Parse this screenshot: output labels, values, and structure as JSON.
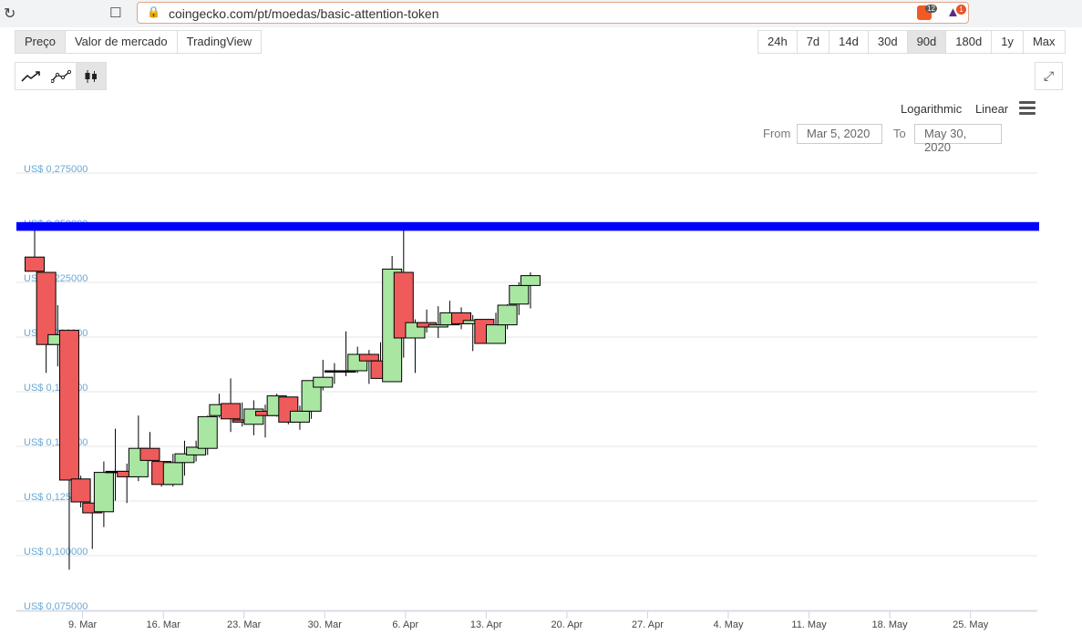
{
  "browser": {
    "url": "coingecko.com/pt/moedas/basic-attention-token",
    "ext1_badge": "12",
    "ext2_badge": "1"
  },
  "tabs": [
    "Preço",
    "Valor de mercado",
    "TradingView"
  ],
  "ranges": [
    "24h",
    "7d",
    "14d",
    "30d",
    "90d",
    "180d",
    "1y",
    "Max"
  ],
  "scales": {
    "log": "Logarithmic",
    "linear": "Linear"
  },
  "range_inputs": {
    "from_label": "From",
    "from_value": "Mar 5, 2020",
    "to_label": "To",
    "to_value": "May 30, 2020"
  },
  "colors": {
    "up": "#a8e6a1",
    "down": "#ef5b5b",
    "axis_text": "#6ba9d6",
    "grid": "#e6e6e6",
    "band": "#0000ff"
  },
  "chart_data": {
    "type": "candlestick",
    "y_ticks": [
      "US$ 0,275000",
      "US$ 0,250000",
      "US$ 0,225000",
      "US$ 0,200000",
      "US$ 0,175000",
      "US$ 0,150000",
      "US$ 0,125000",
      "US$ 0,100000",
      "US$ 0,075000"
    ],
    "y_tick_values": [
      0.275,
      0.25,
      0.225,
      0.2,
      0.175,
      0.15,
      0.125,
      0.1,
      0.075
    ],
    "ylim": [
      0.075,
      0.278
    ],
    "x_ticks": [
      "9. Mar",
      "16. Mar",
      "23. Mar",
      "30. Mar",
      "6. Apr",
      "13. Apr",
      "20. Apr",
      "27. Apr",
      "4. May",
      "11. May",
      "18. May",
      "25. May"
    ],
    "x_tick_days": [
      4,
      11,
      18,
      25,
      32,
      39,
      46,
      53,
      60,
      67,
      74,
      81
    ],
    "highlight_band": [
      0.2465,
      0.2505
    ],
    "candles": [
      {
        "day": 0,
        "o": 0.2345,
        "h": 0.2485,
        "l": 0.228,
        "c": 0.228
      },
      {
        "day": 1,
        "o": 0.2275,
        "h": 0.2275,
        "l": 0.1815,
        "c": 0.1945
      },
      {
        "day": 2,
        "o": 0.1945,
        "h": 0.2125,
        "l": 0.1845,
        "c": 0.199
      },
      {
        "day": 3,
        "o": 0.201,
        "h": 0.201,
        "l": 0.0915,
        "c": 0.1325
      },
      {
        "day": 4,
        "o": 0.133,
        "h": 0.1345,
        "l": 0.12,
        "c": 0.1225
      },
      {
        "day": 5,
        "o": 0.122,
        "h": 0.122,
        "l": 0.101,
        "c": 0.1175
      },
      {
        "day": 6,
        "o": 0.118,
        "h": 0.141,
        "l": 0.111,
        "c": 0.136
      },
      {
        "day": 7,
        "o": 0.136,
        "h": 0.156,
        "l": 0.123,
        "c": 0.1365
      },
      {
        "day": 8,
        "o": 0.1365,
        "h": 0.14,
        "l": 0.122,
        "c": 0.134
      },
      {
        "day": 9,
        "o": 0.134,
        "h": 0.162,
        "l": 0.132,
        "c": 0.147
      },
      {
        "day": 10,
        "o": 0.147,
        "h": 0.1545,
        "l": 0.141,
        "c": 0.1415
      },
      {
        "day": 11,
        "o": 0.141,
        "h": 0.141,
        "l": 0.1295,
        "c": 0.1305
      },
      {
        "day": 12,
        "o": 0.1305,
        "h": 0.1445,
        "l": 0.1295,
        "c": 0.1405
      },
      {
        "day": 13,
        "o": 0.1405,
        "h": 0.1505,
        "l": 0.1345,
        "c": 0.1445
      },
      {
        "day": 14,
        "o": 0.144,
        "h": 0.1505,
        "l": 0.141,
        "c": 0.1475
      },
      {
        "day": 15,
        "o": 0.147,
        "h": 0.162,
        "l": 0.144,
        "c": 0.1615
      },
      {
        "day": 16,
        "o": 0.162,
        "h": 0.172,
        "l": 0.161,
        "c": 0.167
      },
      {
        "day": 17,
        "o": 0.1675,
        "h": 0.179,
        "l": 0.1545,
        "c": 0.1605
      },
      {
        "day": 18,
        "o": 0.16,
        "h": 0.168,
        "l": 0.157,
        "c": 0.159
      },
      {
        "day": 19,
        "o": 0.158,
        "h": 0.169,
        "l": 0.153,
        "c": 0.165
      },
      {
        "day": 20,
        "o": 0.164,
        "h": 0.167,
        "l": 0.152,
        "c": 0.162
      },
      {
        "day": 21,
        "o": 0.162,
        "h": 0.172,
        "l": 0.1615,
        "c": 0.171
      },
      {
        "day": 22,
        "o": 0.1705,
        "h": 0.1705,
        "l": 0.158,
        "c": 0.159
      },
      {
        "day": 23,
        "o": 0.159,
        "h": 0.1665,
        "l": 0.1555,
        "c": 0.164
      },
      {
        "day": 24,
        "o": 0.164,
        "h": 0.178,
        "l": 0.1605,
        "c": 0.178
      },
      {
        "day": 25,
        "o": 0.175,
        "h": 0.1875,
        "l": 0.1735,
        "c": 0.1795
      },
      {
        "day": 26,
        "o": 0.1825,
        "h": 0.186,
        "l": 0.1765,
        "c": 0.1825
      },
      {
        "day": 27,
        "o": 0.1825,
        "h": 0.2005,
        "l": 0.18,
        "c": 0.1825
      },
      {
        "day": 28,
        "o": 0.1825,
        "h": 0.1935,
        "l": 0.1815,
        "c": 0.19
      },
      {
        "day": 29,
        "o": 0.19,
        "h": 0.192,
        "l": 0.1765,
        "c": 0.187
      },
      {
        "day": 30,
        "o": 0.187,
        "h": 0.1955,
        "l": 0.1795,
        "c": 0.179
      },
      {
        "day": 31,
        "o": 0.1775,
        "h": 0.235,
        "l": 0.1775,
        "c": 0.229
      },
      {
        "day": 32,
        "o": 0.2275,
        "h": 0.2485,
        "l": 0.1885,
        "c": 0.1975
      },
      {
        "day": 33,
        "o": 0.1975,
        "h": 0.206,
        "l": 0.1815,
        "c": 0.2045
      },
      {
        "day": 34,
        "o": 0.2045,
        "h": 0.2105,
        "l": 0.2,
        "c": 0.2025
      },
      {
        "day": 35,
        "o": 0.2025,
        "h": 0.212,
        "l": 0.1975,
        "c": 0.2035
      },
      {
        "day": 36,
        "o": 0.2035,
        "h": 0.2145,
        "l": 0.2035,
        "c": 0.209
      },
      {
        "day": 37,
        "o": 0.209,
        "h": 0.2115,
        "l": 0.2015,
        "c": 0.204
      },
      {
        "day": 38,
        "o": 0.204,
        "h": 0.208,
        "l": 0.1915,
        "c": 0.2055
      },
      {
        "day": 39,
        "o": 0.206,
        "h": 0.206,
        "l": 0.195,
        "c": 0.195
      },
      {
        "day": 40,
        "o": 0.195,
        "h": 0.209,
        "l": 0.195,
        "c": 0.2035
      },
      {
        "day": 41,
        "o": 0.2035,
        "h": 0.213,
        "l": 0.2015,
        "c": 0.2125
      },
      {
        "day": 42,
        "o": 0.213,
        "h": 0.223,
        "l": 0.208,
        "c": 0.2215
      },
      {
        "day": 43,
        "o": 0.2215,
        "h": 0.2275,
        "l": 0.211,
        "c": 0.226
      }
    ]
  }
}
